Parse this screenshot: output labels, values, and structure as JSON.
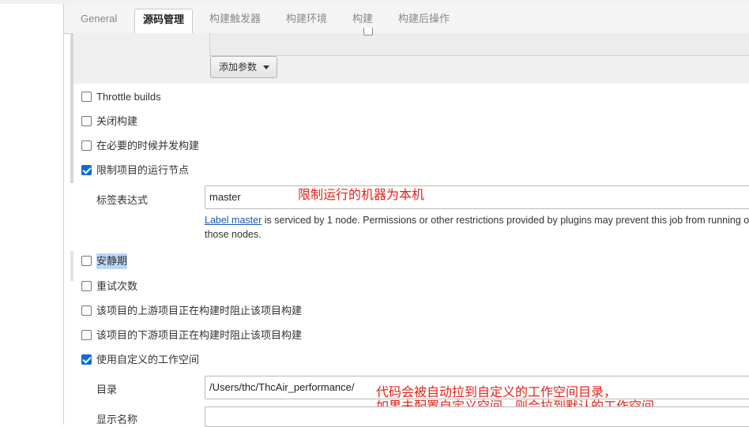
{
  "tabs": [
    {
      "label": "General"
    },
    {
      "label": "源码管理"
    },
    {
      "label": "构建触发器"
    },
    {
      "label": "构建环境"
    },
    {
      "label": "构建"
    },
    {
      "label": "构建后操作"
    }
  ],
  "params": {
    "add_button": "添加参数"
  },
  "options": {
    "throttle": {
      "label": "Throttle builds",
      "checked": false
    },
    "close_build": {
      "label": "关闭构建",
      "checked": false
    },
    "concurrent": {
      "label": "在必要的时候并发构建",
      "checked": false
    },
    "restrict_node": {
      "label": "限制项目的运行节点",
      "checked": true
    },
    "quiet_period": {
      "label": "安静期",
      "checked": false
    },
    "retry": {
      "label": "重试次数",
      "checked": false
    },
    "block_upstream": {
      "label": "该项目的上游项目正在构建时阻止该项目构建",
      "checked": false
    },
    "block_downstream": {
      "label": "该项目的下游项目正在构建时阻止该项目构建",
      "checked": false
    },
    "custom_workspace": {
      "label": "使用自定义的工作空间",
      "checked": true
    }
  },
  "label_expr": {
    "label": "标签表达式",
    "value": "master",
    "help_link": "Label master",
    "help_text": " is serviced by 1 node. Permissions or other restrictions provided by plugins may prevent this job from running on those nodes."
  },
  "workspace": {
    "dir_label": "目录",
    "dir_value": "/Users/thc/ThcAir_performance/",
    "display_label": "显示名称",
    "display_value": ""
  },
  "annotations": {
    "restrict_note": "限制运行的机器为本机",
    "workspace_note_1": "代码会被自动拉到自定义的工作空间目录，",
    "workspace_note_2": "如果未配置自定义空间，则会拉到默认的工作空间"
  },
  "colors": {
    "annotation": "#e2231a",
    "checkbox_checked": "#0a6bdb",
    "link": "#1b55b5"
  }
}
